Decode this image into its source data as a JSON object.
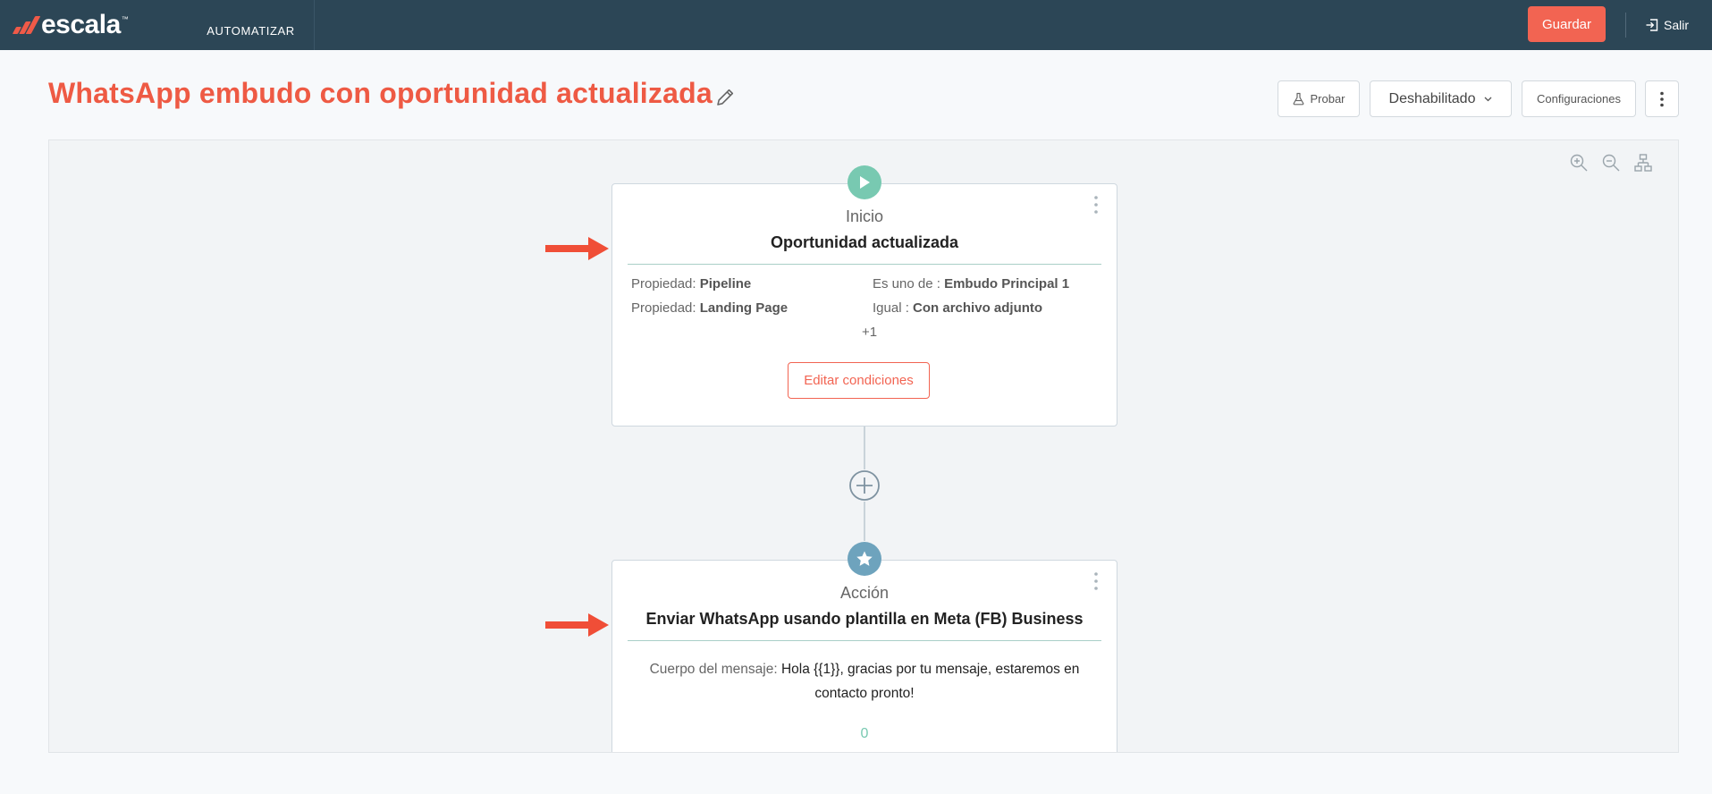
{
  "header": {
    "brand": "escala",
    "brand_tm": "™",
    "nav_tab": "AUTOMATIZAR",
    "save_label": "Guardar",
    "exit_label": "Salir"
  },
  "page": {
    "title": "WhatsApp embudo con oportunidad actualizada",
    "toolbar": {
      "test_label": "Probar",
      "status_label": "Deshabilitado",
      "config_label": "Configuraciones"
    }
  },
  "flow": {
    "trigger": {
      "kind": "Inicio",
      "title": "Oportunidad actualizada",
      "conditions": [
        {
          "prop_label": "Propiedad:",
          "prop_value": "Pipeline",
          "op_label": "Es uno de :",
          "op_value": "Embudo Principal 1"
        },
        {
          "prop_label": "Propiedad:",
          "prop_value": "Landing Page",
          "op_label": "Igual :",
          "op_value": "Con archivo adjunto"
        }
      ],
      "more_count": "+1",
      "edit_label": "Editar condiciones"
    },
    "action": {
      "kind": "Acción",
      "title": "Enviar WhatsApp usando plantilla en Meta (FB) Business",
      "message_label": "Cuerpo del mensaje:",
      "message_text": "Hola {{1}}, gracias por tu mensaje, estaremos en contacto pronto!",
      "count": "0"
    }
  },
  "colors": {
    "topbar": "#2c4656",
    "accent": "#f26452",
    "title": "#ee5a44",
    "trigger_badge": "#78c9b1",
    "action_badge": "#6ea3bd",
    "arrow": "#f04e37"
  },
  "icons": {
    "title_edit": "pencil-icon",
    "test": "flask-icon",
    "status": "chevron-down-icon",
    "more": "vertical-dots-icon",
    "zoom_in": "zoom-in-icon",
    "zoom_out": "zoom-out-icon",
    "layout": "hierarchy-icon",
    "trigger": "play-icon",
    "action": "star-icon",
    "add": "plus-circle-icon",
    "exit": "logout-icon"
  }
}
